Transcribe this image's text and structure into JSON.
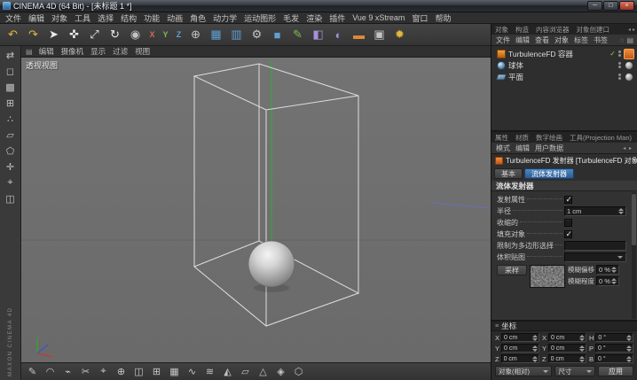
{
  "window": {
    "title": "CINEMA 4D (64 Bit) - [未标题 1 *]"
  },
  "glyphs": {
    "minimize": "─",
    "maximize": "□",
    "close": "×",
    "burger": "≡",
    "search": "◌",
    "panel_menu": "▤",
    "arrow_left": "◂",
    "arrow_right": "▸",
    "viewport_menu": "▤"
  },
  "menubar": {
    "items": [
      "文件",
      "编辑",
      "对象",
      "工具",
      "选择",
      "结构",
      "功能",
      "动画",
      "角色",
      "动力学",
      "运动图形",
      "毛发",
      "渲染",
      "插件",
      "Vue 9 xStream",
      "窗口",
      "帮助"
    ]
  },
  "toolbar": {
    "icons": [
      {
        "name": "undo-icon",
        "glyph": "↶",
        "cls": "c-yellow"
      },
      {
        "name": "redo-icon",
        "glyph": "↷",
        "cls": "c-yellow"
      },
      {
        "name": "live-selection-icon",
        "glyph": "➤",
        "cls": "c-white"
      },
      {
        "name": "move-icon",
        "glyph": "✜",
        "cls": "c-white"
      },
      {
        "name": "scale-icon",
        "glyph": "⤢",
        "cls": "c-white"
      },
      {
        "name": "rotate-icon",
        "glyph": "↻",
        "cls": "c-white"
      },
      {
        "name": "last-tool-icon",
        "glyph": "◉",
        "cls": "c-gray"
      },
      {
        "name": "lock-x-axis-icon",
        "glyph": "X",
        "cls": "c-red ax"
      },
      {
        "name": "lock-y-axis-icon",
        "glyph": "Y",
        "cls": "c-green ax"
      },
      {
        "name": "lock-z-axis-icon",
        "glyph": "Z",
        "cls": "c-blue ax"
      },
      {
        "name": "coordinate-system-icon",
        "glyph": "⊕",
        "cls": "c-gray"
      },
      {
        "name": "render-view-icon",
        "glyph": "▦",
        "cls": "c-blue"
      },
      {
        "name": "render-picture-viewer-icon",
        "glyph": "▥",
        "cls": "c-blue"
      },
      {
        "name": "render-settings-icon",
        "glyph": "⚙",
        "cls": "c-gray"
      },
      {
        "name": "primitive-cube-icon",
        "glyph": "■",
        "cls": "c-blue"
      },
      {
        "name": "spline-pen-icon",
        "glyph": "✎",
        "cls": "c-green"
      },
      {
        "name": "generators-icon",
        "glyph": "◧",
        "cls": "c-purple"
      },
      {
        "name": "deformers-icon",
        "glyph": "◐",
        "cls": "c-purple"
      },
      {
        "name": "floor-icon",
        "glyph": "▬",
        "cls": "c-orange"
      },
      {
        "name": "camera-icon",
        "glyph": "▣",
        "cls": "c-gray"
      },
      {
        "name": "light-icon",
        "glyph": "✹",
        "cls": "c-yellow"
      }
    ]
  },
  "left_toolbar": {
    "logo": "MAXON CINEMA 4D",
    "icons": [
      {
        "name": "make-editable-icon",
        "glyph": "⇄"
      },
      {
        "name": "model-mode-icon",
        "glyph": "◻"
      },
      {
        "name": "texture-mode-icon",
        "glyph": "▩"
      },
      {
        "name": "workplane-mode-icon",
        "glyph": "⊞"
      },
      {
        "name": "points-mode-icon",
        "glyph": "∴"
      },
      {
        "name": "edges-mode-icon",
        "glyph": "▱"
      },
      {
        "name": "polygons-mode-icon",
        "glyph": "⬠"
      },
      {
        "name": "axis-mode-icon",
        "glyph": "✛"
      },
      {
        "name": "snap-icon",
        "glyph": "⌖"
      },
      {
        "name": "viewport-solo-icon",
        "glyph": "◫"
      }
    ]
  },
  "viewport": {
    "menu_items": [
      "编辑",
      "摄像机",
      "显示",
      "过滤",
      "视图"
    ],
    "label": "透视视图"
  },
  "bottom_toolbar": {
    "icons": [
      {
        "name": "pen-tool-icon",
        "glyph": "✎"
      },
      {
        "name": "arc-tool-icon",
        "glyph": "◠"
      },
      {
        "name": "magnet-tool-icon",
        "glyph": "⌁"
      },
      {
        "name": "knife-tool-icon",
        "glyph": "✂"
      },
      {
        "name": "measure-tool-icon",
        "glyph": "⌖"
      },
      {
        "name": "axis-tool-icon",
        "glyph": "⊕"
      },
      {
        "name": "mirror-tool-icon",
        "glyph": "◫"
      },
      {
        "name": "array-tool-icon",
        "glyph": "⊞"
      },
      {
        "name": "lattice-tool-icon",
        "glyph": "▦"
      },
      {
        "name": "bend-tool-icon",
        "glyph": "∿"
      },
      {
        "name": "twist-tool-icon",
        "glyph": "≋"
      },
      {
        "name": "bulge-tool-icon",
        "glyph": "◭"
      },
      {
        "name": "shear-tool-icon",
        "glyph": "▱"
      },
      {
        "name": "taper-tool-icon",
        "glyph": "△"
      },
      {
        "name": "ffd-tool-icon",
        "glyph": "◈"
      },
      {
        "name": "wrap-tool-icon",
        "glyph": "⬡"
      }
    ]
  },
  "object_manager": {
    "tabs": [
      "对象",
      "构造",
      "内容浏览器",
      "对象创建口"
    ],
    "menu_items": [
      "文件",
      "编辑",
      "查看",
      "对象",
      "标签",
      "书签"
    ],
    "objects": [
      {
        "name": "TurbulenceFD 容器"
      },
      {
        "name": "球体"
      },
      {
        "name": "平面"
      }
    ]
  },
  "attribute_manager": {
    "tabs": [
      "属性",
      "材质",
      "数字绘画",
      "工具(Projection Man)"
    ],
    "mode_items": [
      "模式",
      "编辑",
      "用户数据"
    ],
    "object_title": "TurbulenceFD 发射器 [TurbulenceFD 对象]",
    "section_buttons": [
      {
        "label": "基本",
        "cls": ""
      },
      {
        "label": "流体发射器",
        "cls": "active"
      }
    ],
    "group_title": "流体发射器",
    "props": {
      "emission": {
        "label": "发射属性",
        "checked": true
      },
      "radius": {
        "label": "半径",
        "value": "1 cm"
      },
      "shrink": {
        "label": "收缩的",
        "checked": false
      },
      "fill_object": {
        "label": "填充对象",
        "checked": true
      },
      "polygon_selection": {
        "label": "限制为多边形选择",
        "value": ""
      },
      "volume_map": {
        "label": "体积贴图",
        "value": ""
      },
      "sample_button": "采样",
      "blur_offset": {
        "label": "模糊偏移",
        "value": "0 %"
      },
      "blur_strength": {
        "label": "模糊程度",
        "value": "0 %"
      }
    }
  },
  "coordinates": {
    "title": "坐标",
    "rows": [
      {
        "a": "X",
        "av": "0 cm",
        "b": "X",
        "bv": "0 cm",
        "c": "H",
        "cv": "0 °"
      },
      {
        "a": "Y",
        "av": "0 cm",
        "b": "Y",
        "bv": "0 cm",
        "c": "P",
        "cv": "0 °"
      },
      {
        "a": "Z",
        "av": "0 cm",
        "b": "Z",
        "bv": "0 cm",
        "c": "B",
        "cv": "0 °"
      }
    ],
    "mode_dropdown": "对象(相对)",
    "size_dropdown": "尺寸",
    "apply_button": "应用"
  }
}
